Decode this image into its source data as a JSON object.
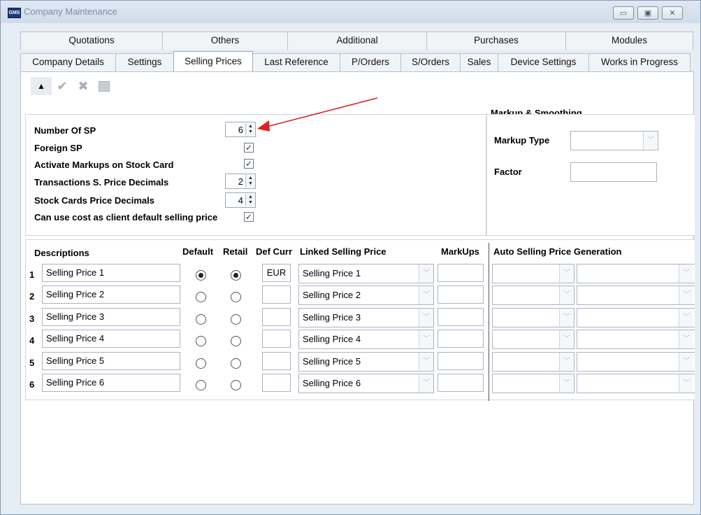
{
  "window": {
    "title": "Company Maintenance",
    "app_icon": "GMS"
  },
  "window_buttons": [
    "minimize-icon",
    "maximize-icon",
    "close-icon"
  ],
  "tabs_top": [
    "Quotations",
    "Others",
    "Additional",
    "Purchases",
    "Modules"
  ],
  "tabs_bottom": [
    "Company Details",
    "Settings",
    "Selling Prices",
    "Last Reference",
    "P/Orders",
    "S/Orders",
    "Sales",
    "Device Settings",
    "Works in Progress"
  ],
  "active_tab": "Selling Prices",
  "toolbar": [
    "up-arrow-icon",
    "check-icon",
    "cancel-icon",
    "calendar-icon"
  ],
  "settings": {
    "number_of_sp": {
      "label": "Number Of SP",
      "value": "6"
    },
    "foreign_sp": {
      "label": "Foreign SP",
      "checked": true
    },
    "activate_markups": {
      "label": "Activate Markups on Stock Card",
      "checked": true
    },
    "transactions_decimals": {
      "label": "Transactions S. Price Decimals",
      "value": "2"
    },
    "stock_cards_decimals": {
      "label": "Stock Cards Price Decimals",
      "value": "4"
    },
    "use_cost": {
      "label": "Can use cost as client default selling price",
      "checked": true
    }
  },
  "markup": {
    "section_title": "Markup & Smoothing",
    "type_label": "Markup Type",
    "type_value": "",
    "factor_label": "Factor",
    "factor_value": ""
  },
  "grid": {
    "headers": {
      "descriptions": "Descriptions",
      "default": "Default",
      "retail": "Retail",
      "def_curr": "Def Curr",
      "linked": "Linked Selling Price",
      "markups": "MarkUps",
      "auto": "Auto Selling Price Generation"
    },
    "rows": [
      {
        "num": "1",
        "desc": "Selling Price 1",
        "default": true,
        "retail": true,
        "curr": "EUR",
        "linked": "Selling Price 1"
      },
      {
        "num": "2",
        "desc": "Selling Price 2",
        "default": false,
        "retail": false,
        "curr": "",
        "linked": "Selling Price 2"
      },
      {
        "num": "3",
        "desc": "Selling Price 3",
        "default": false,
        "retail": false,
        "curr": "",
        "linked": "Selling Price 3"
      },
      {
        "num": "4",
        "desc": "Selling Price 4",
        "default": false,
        "retail": false,
        "curr": "",
        "linked": "Selling Price 4"
      },
      {
        "num": "5",
        "desc": "Selling Price 5",
        "default": false,
        "retail": false,
        "curr": "",
        "linked": "Selling Price 5"
      },
      {
        "num": "6",
        "desc": "Selling Price 6",
        "default": false,
        "retail": false,
        "curr": "",
        "linked": "Selling Price 6"
      }
    ]
  },
  "annotation_color": "#e02020"
}
